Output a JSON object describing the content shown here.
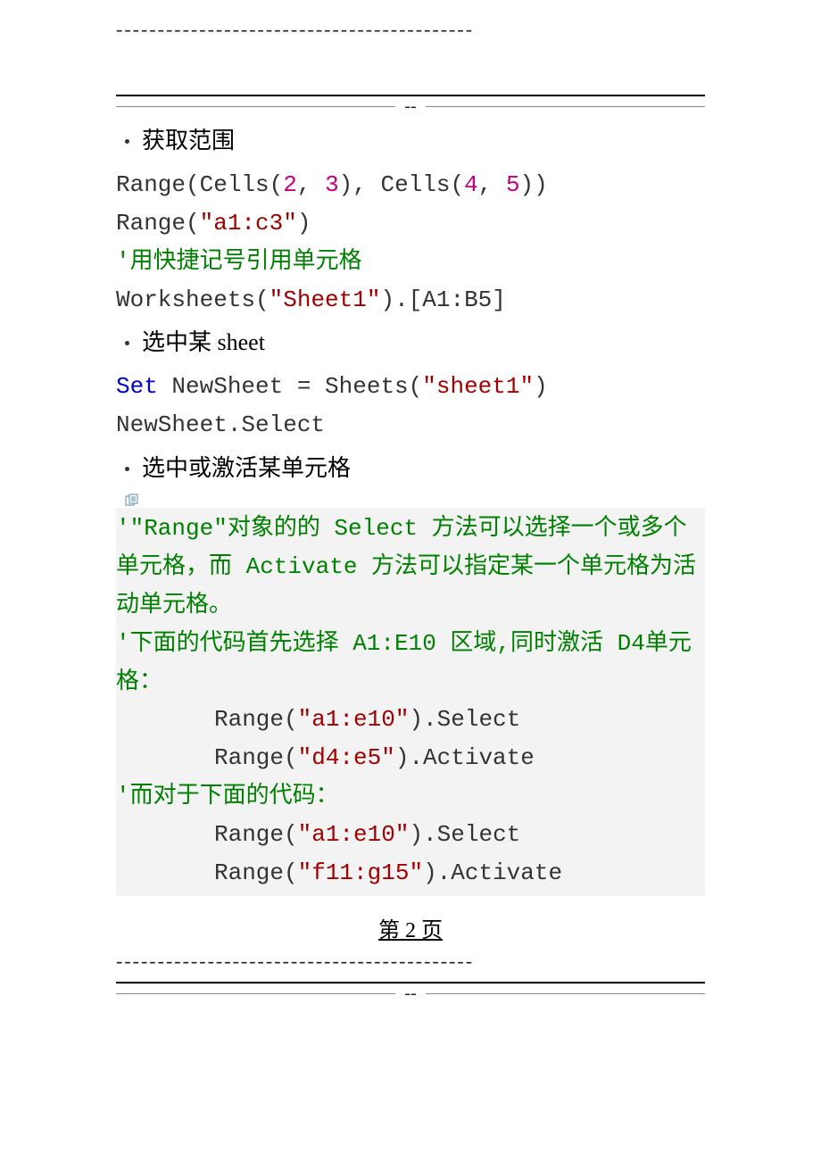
{
  "rules": {
    "dashes_top": "-------------------------------------------",
    "double_dash": "--",
    "dashes_bottom": "-------------------------------------------"
  },
  "bullets": {
    "b1": "获取范围",
    "b2": "选中某 sheet",
    "b3": "选中或激活某单元格"
  },
  "code": {
    "l1_a": "Range(Cells(",
    "l1_n1": "2",
    "l1_c1": ", ",
    "l1_n2": "3",
    "l1_c2": "), Cells(",
    "l1_n3": "4",
    "l1_c3": ", ",
    "l1_n4": "5",
    "l1_c4": "))",
    "l2_a": "Range(",
    "l2_s": "\"a1:c3\"",
    "l2_b": ")",
    "l3": "'用快捷记号引用单元格",
    "l4_a": "Worksheets(",
    "l4_s": "\"Sheet1\"",
    "l4_b": ").[A1:B5]",
    "l5_k": "Set",
    "l5_a": " NewSheet = Sheets(",
    "l5_s": "\"sheet1\"",
    "l5_b": ")",
    "l6": "NewSheet.Select",
    "c1": "'\"Range\"对象的的 Select 方法可以选择一个或多个单元格，而 Activate 方法可以指定某一个单元格为活动单元格。",
    "c2": "'下面的代码首先选择 A1:E10 区域,同时激活 D4单元格：",
    "r1_a": "Range(",
    "r1_s": "\"a1:e10\"",
    "r1_b": ").Select",
    "r2_a": "Range(",
    "r2_s": "\"d4:e5\"",
    "r2_b": ").Activate",
    "c3": "'而对于下面的代码：",
    "r3_a": "Range(",
    "r3_s": "\"a1:e10\"",
    "r3_b": ").Select",
    "r4_a": "Range(",
    "r4_s": "\"f11:g15\"",
    "r4_b": ").Activate"
  },
  "page_number": "第 2 页"
}
